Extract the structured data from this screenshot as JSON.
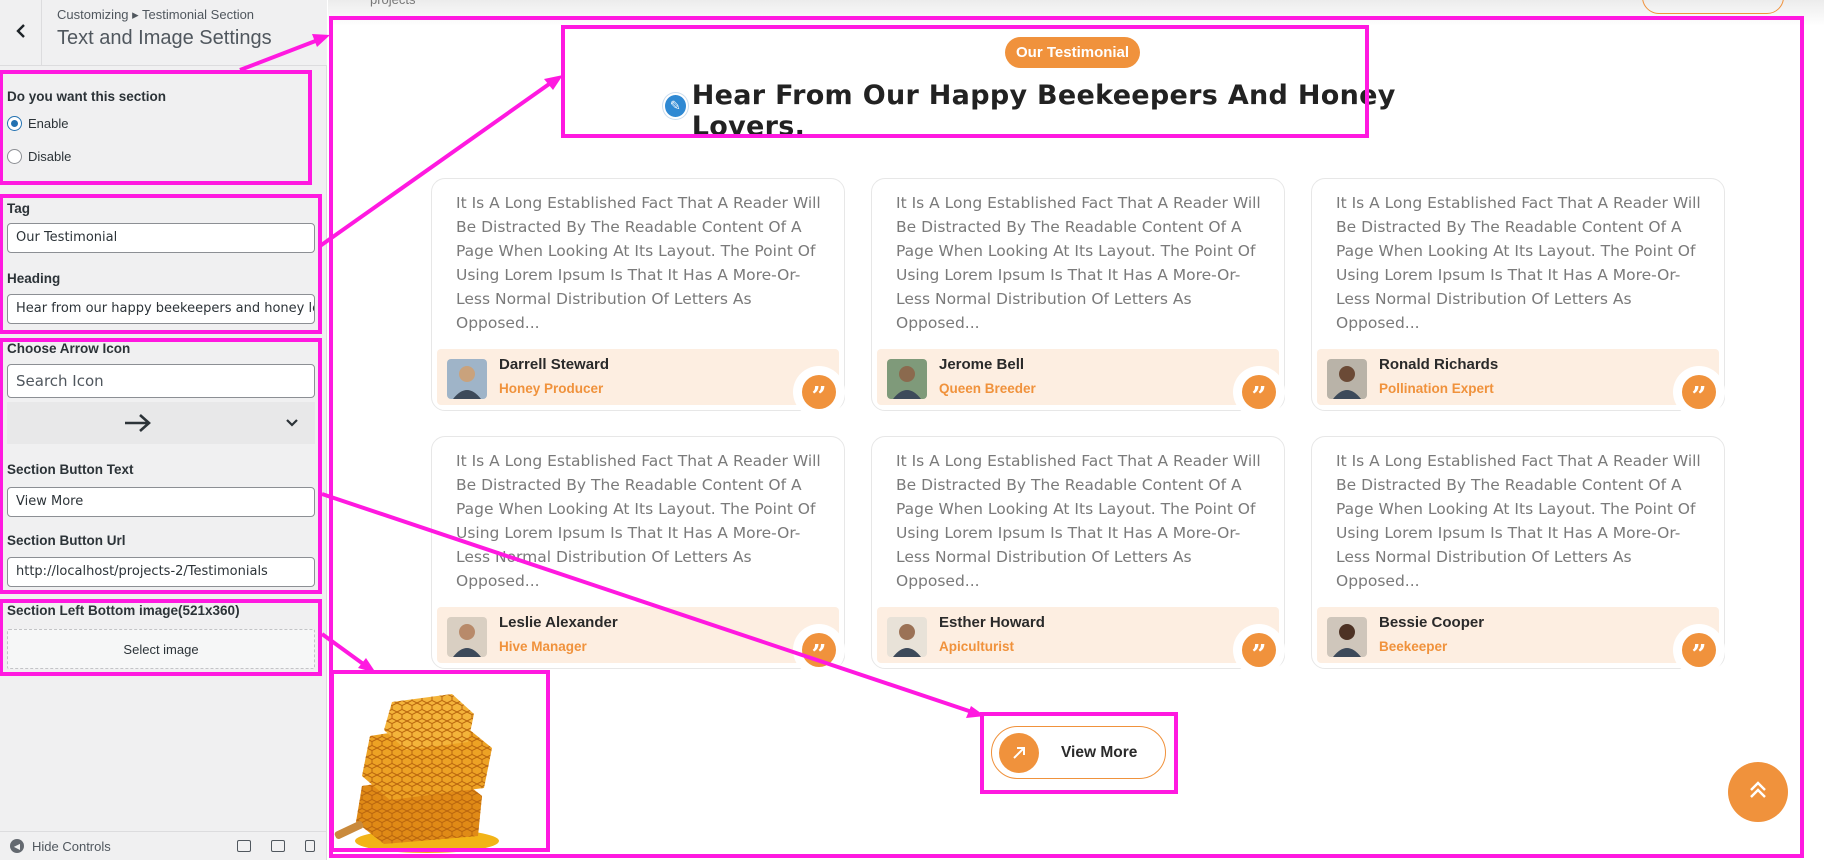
{
  "customizer": {
    "breadcrumb": "Customizing ▸ Testimonial Section",
    "title": "Text and Image Settings",
    "section_toggle": {
      "label": "Do you want this section",
      "options": [
        "Enable",
        "Disable"
      ],
      "selected": "Enable"
    },
    "tag": {
      "label": "Tag",
      "value": "Our Testimonial"
    },
    "heading": {
      "label": "Heading",
      "value": "Hear from our happy beekeepers and honey lc"
    },
    "arrow_icon": {
      "label": "Choose Arrow Icon",
      "search_placeholder": "Search Icon",
      "selected_icon": "arrow-right-icon"
    },
    "button_text": {
      "label": "Section Button Text",
      "value": "View More"
    },
    "button_url": {
      "label": "Section Button Url",
      "value": "http://localhost/projects-2/Testimonials"
    },
    "left_image": {
      "label": "Section Left Bottom image(521x360)",
      "button": "Select image"
    },
    "footer": {
      "hide_controls": "Hide Controls",
      "device_icons": [
        "desktop-icon",
        "tablet-icon",
        "mobile-icon"
      ]
    }
  },
  "preview": {
    "top_nav_text": "projects",
    "tag": "Our Testimonial",
    "heading": "Hear From Our Happy Beekeepers And Honey Lovers.",
    "testimonial_text": "It Is A Long Established Fact That A Reader Will Be Distracted By The Readable Content Of A Page When Looking At Its Layout. The Point Of Using Lorem Ipsum Is That It Has A More-Or-Less Normal Distribution Of Letters As Opposed...",
    "testimonials": [
      {
        "name": "Darrell Steward",
        "role": "Honey Producer"
      },
      {
        "name": "Jerome Bell",
        "role": "Queen Breeder"
      },
      {
        "name": "Ronald Richards",
        "role": "Pollination Expert"
      },
      {
        "name": "Leslie Alexander",
        "role": "Hive Manager"
      },
      {
        "name": "Esther Howard",
        "role": "Apiculturist"
      },
      {
        "name": "Bessie Cooper",
        "role": "Beekeeper"
      }
    ],
    "quote_icon": "”",
    "view_more": "View More"
  },
  "colors": {
    "accent": "#f0923c",
    "annotation": "#ff19e0",
    "card_footer": "#fdeee1",
    "wp_blue": "#2271b1"
  }
}
